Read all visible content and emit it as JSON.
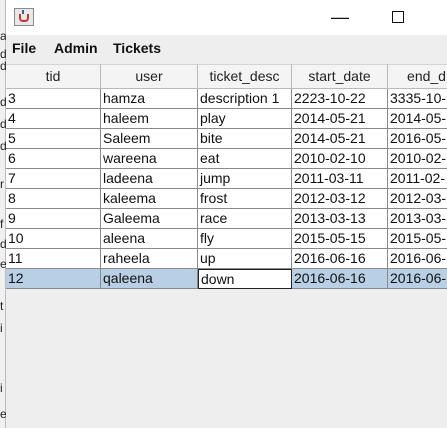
{
  "window": {
    "minimize_glyph": "—",
    "icon": "java-cup-icon"
  },
  "menu": [
    "File",
    "Admin",
    "Tickets"
  ],
  "table": {
    "columns": [
      "tid",
      "user",
      "ticket_desc",
      "start_date",
      "end_d"
    ],
    "rows": [
      [
        "3",
        "hamza",
        "description 1",
        "2223-10-22",
        "3335-10-"
      ],
      [
        "4",
        "haleem",
        "play",
        "2014-05-21",
        "2014-05-"
      ],
      [
        "5",
        "Saleem",
        "bite",
        "2014-05-21",
        "2016-05-"
      ],
      [
        "6",
        "wareena",
        "eat",
        "2010-02-10",
        "2010-02-"
      ],
      [
        "7",
        "ladeena",
        "jump",
        "2011-03-11",
        "2011-02-"
      ],
      [
        "8",
        "kaleema",
        "frost",
        "2012-03-12",
        "2012-03-"
      ],
      [
        "9",
        "Galeema",
        "race",
        "2013-03-13",
        "2013-03-"
      ],
      [
        "10",
        "aleena",
        "fly",
        "2015-05-15",
        "2015-05-"
      ],
      [
        "11",
        "raheela",
        "up",
        "2016-06-16",
        "2016-06-"
      ],
      [
        "12",
        "qaleena",
        "down",
        "2016-06-16",
        "2016-06-"
      ]
    ],
    "selected_row": 9,
    "editing_cell": "ticket_desc"
  },
  "background_window_fragments": [
    "a",
    "d",
    "d",
    "d",
    "d",
    "d",
    "r",
    "f",
    "d",
    "e",
    "t",
    "i",
    "i",
    "e"
  ]
}
